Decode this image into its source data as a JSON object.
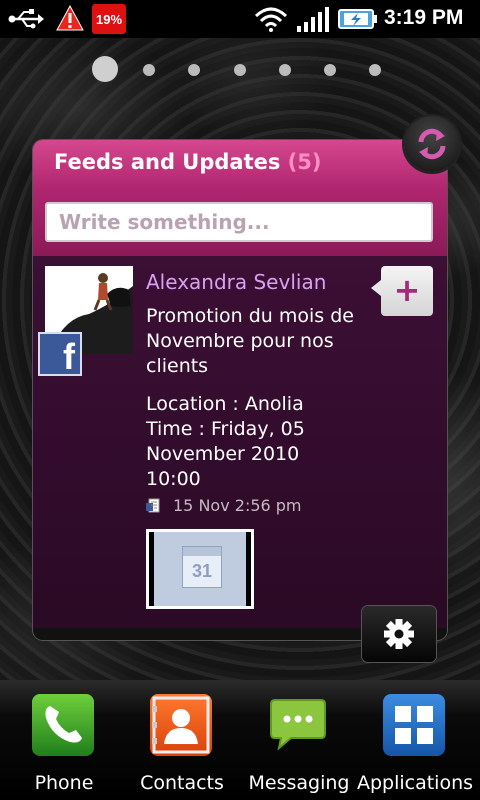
{
  "status_bar": {
    "battery_badge": "19%",
    "time": "3:19 PM",
    "icons": [
      "usb-icon",
      "warning-icon",
      "battery-low-badge",
      "wifi-icon",
      "signal-icon",
      "battery-charging-icon"
    ]
  },
  "home": {
    "page_count": 7,
    "active_page": 0
  },
  "widget": {
    "title": "Feeds and Updates",
    "count": "(5)",
    "input_placeholder": "Write something...",
    "post": {
      "author": "Alexandra Sevlian",
      "source": "facebook",
      "text": "Promotion du mois de Novembre pour nos clients",
      "location": "Location : Anolia",
      "time_line1": "Time : Friday, 05",
      "time_line2": "November 2010",
      "time_line3": "10:00",
      "timestamp": "15 Nov 2:56 pm",
      "calendar_day": "31"
    },
    "colors": {
      "header": "#c23380",
      "body": "#3c0f35",
      "author": "#d9a0f2",
      "count": "#ff8fc0"
    }
  },
  "dock": {
    "items": [
      {
        "label": "Phone",
        "icon": "phone-icon"
      },
      {
        "label": "Contacts",
        "icon": "contacts-icon"
      },
      {
        "label": "Messaging",
        "icon": "messaging-icon"
      },
      {
        "label": "Applications",
        "icon": "applications-icon"
      }
    ]
  }
}
